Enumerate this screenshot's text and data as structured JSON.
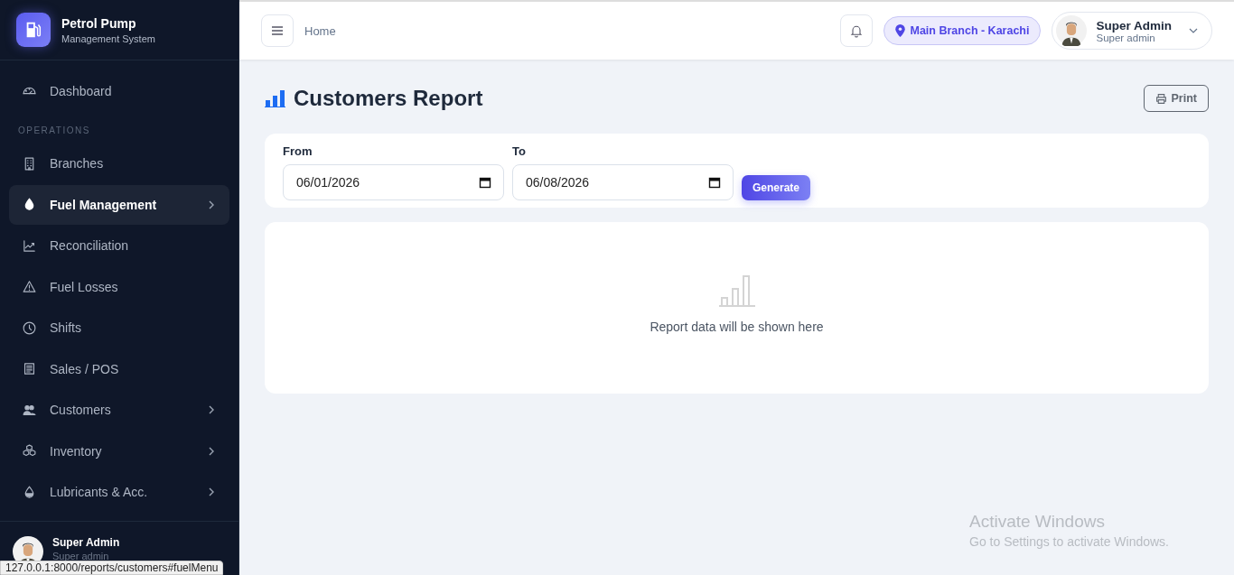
{
  "brand": {
    "title": "Petrol Pump",
    "subtitle": "Management System"
  },
  "sidebar": {
    "items": [
      {
        "kind": "link",
        "label": "Dashboard",
        "selected": false,
        "expandable": false
      },
      {
        "kind": "section",
        "label": "OPERATIONS"
      },
      {
        "kind": "link",
        "label": "Branches",
        "selected": false,
        "expandable": false
      },
      {
        "kind": "link",
        "label": "Fuel Management",
        "selected": true,
        "expandable": true
      },
      {
        "kind": "link",
        "label": "Reconciliation",
        "selected": false,
        "expandable": false
      },
      {
        "kind": "link",
        "label": "Fuel Losses",
        "selected": false,
        "expandable": false
      },
      {
        "kind": "link",
        "label": "Shifts",
        "selected": false,
        "expandable": false
      },
      {
        "kind": "link",
        "label": "Sales / POS",
        "selected": false,
        "expandable": false
      },
      {
        "kind": "link",
        "label": "Customers",
        "selected": false,
        "expandable": true
      },
      {
        "kind": "link",
        "label": "Inventory",
        "selected": false,
        "expandable": true
      },
      {
        "kind": "link",
        "label": "Lubricants & Acc.",
        "selected": false,
        "expandable": true
      }
    ],
    "user": {
      "name": "Super Admin",
      "role": "Super admin"
    }
  },
  "header": {
    "breadcrumb": "Home",
    "branch": "Main Branch - Karachi",
    "user": {
      "name": "Super Admin",
      "role": "Super admin"
    }
  },
  "page": {
    "title": "Customers Report",
    "print_button": "Print",
    "filters": [
      {
        "label": "From",
        "value": "06/01/2026"
      },
      {
        "label": "To",
        "value": "06/08/2026"
      }
    ],
    "generate_button": "Generate",
    "empty_text": "Report data will be shown here"
  },
  "status_url": "127.0.0.1:8000/reports/customers#fuelMenu",
  "os_notice": {
    "title": "Activate Windows",
    "text": "Go to Settings to activate Windows."
  }
}
